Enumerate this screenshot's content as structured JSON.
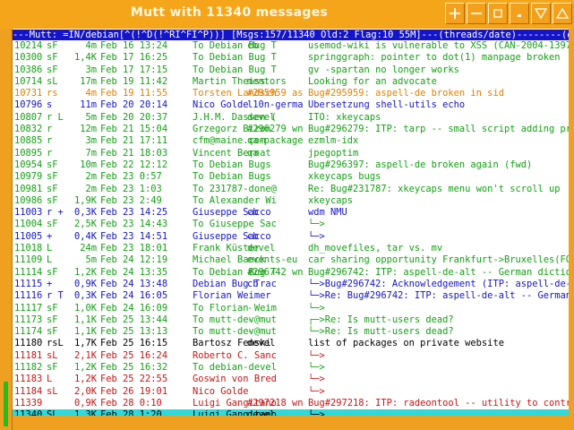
{
  "window": {
    "title": "Mutt with 11340 messages",
    "buttons": [
      "plus-icon",
      "minus-icon",
      "maximize-icon",
      "dot-icon",
      "down-triangle-icon",
      "up-triangle-icon"
    ]
  },
  "statusbar": "---Mutt: =IN/debian[^(!^D(!^RI^FI^P))] [Msgs:157/11340 Old:2 Flag:10 55M]---(threads/date)--------(end)",
  "colors": {
    "status_bg": "#1414c8",
    "selected_bg": "#30d8d8",
    "red": "#c81414",
    "green": "#14a014",
    "blue": "#1414c8",
    "orange": "#e08000",
    "black": "#000000"
  },
  "messages": [
    {
      "num": "10214",
      "flags": "sF",
      "size": "4m",
      "date": "Feb 16 13:24",
      "from": "To Debian Bug T",
      "list": "cb",
      "subject": "usemod-wiki is vulnerable to XSS (CAN-2004-1397)",
      "color": "green"
    },
    {
      "num": "10300",
      "flags": "sF",
      "size": "1,4K",
      "date": "Feb 17 16:25",
      "from": "To Debian Bug T",
      "list": "",
      "subject": "springgraph: pointer to dot(1) manpage broken",
      "color": "green"
    },
    {
      "num": "10386",
      "flags": "sF",
      "size": "3m",
      "date": "Feb 17 17:15",
      "from": "To Debian Bug T",
      "list": "",
      "subject": "gv -spartan no longer works",
      "color": "green"
    },
    {
      "num": "10714",
      "flags": "sL",
      "size": "17m",
      "date": "Feb 19 11:42",
      "from": "Martin Theiss",
      "list": "mentors",
      "subject": "Looking for an advocate",
      "color": "green"
    },
    {
      "num": "10731",
      "flags": "rs",
      "size": "4m",
      "date": "Feb 19 11:55",
      "from": "Torsten Landsch",
      "list": "#295959 as",
      "subject": "Bug#295959: aspell-de broken in sid",
      "color": "orange"
    },
    {
      "num": "10796",
      "flags": "s",
      "size": "11m",
      "date": "Feb 20 20:14",
      "from": "Nico Golde",
      "list": "l10n-germa",
      "subject": "Übersetzung shell-utils echo",
      "color": "blue"
    },
    {
      "num": "10807",
      "flags": "r L",
      "size": "5m",
      "date": "Feb 20 20:37",
      "from": "J.H.M. Dassen (",
      "list": "devel",
      "subject": "ITO: xkeycaps",
      "color": "green"
    },
    {
      "num": "10832",
      "flags": "r",
      "size": "12m",
      "date": "Feb 21 15:04",
      "from": "Grzegorz Bizon",
      "list": "#296279 wn",
      "subject": "Bug#296279: ITP: tarp -- small script adding pro",
      "color": "green"
    },
    {
      "num": "10885",
      "flags": "r",
      "size": "3m",
      "date": "Feb 21 17:11",
      "from": "cfm@maine.com",
      "list": "qa-package",
      "subject": "ezmlm-idx",
      "color": "green"
    },
    {
      "num": "10895",
      "flags": "r",
      "size": "7m",
      "date": "Feb 21 18:03",
      "from": "Vincent Bernat",
      "list": "qa",
      "subject": "jpegoptim",
      "color": "green"
    },
    {
      "num": "10954",
      "flags": "sF",
      "size": "10m",
      "date": "Feb 22 12:12",
      "from": "To Debian Bugs",
      "list": "",
      "subject": "Bug#296397: aspell-de broken again (fwd)",
      "color": "green"
    },
    {
      "num": "10979",
      "flags": "sF",
      "size": "2m",
      "date": "Feb 23 0:57",
      "from": "To Debian Bugs",
      "list": "",
      "subject": "xkeycaps bugs",
      "color": "green"
    },
    {
      "num": "10981",
      "flags": "sF",
      "size": "2m",
      "date": "Feb 23 1:03",
      "from": "To 231787-done@",
      "list": "",
      "subject": "Re: Bug#231787: xkeycaps menu won't scroll up",
      "color": "green"
    },
    {
      "num": "10986",
      "flags": "sF",
      "size": "1,9K",
      "date": "Feb 23 2:49",
      "from": "To Alexander Wi",
      "list": "",
      "subject": "xkeycaps",
      "color": "green"
    },
    {
      "num": "11003",
      "flags": "r +",
      "size": "0,3K",
      "date": "Feb 23 14:25",
      "from": "Giuseppe Sacco",
      "list": "cb",
      "subject": "wdm NMU",
      "color": "blue"
    },
    {
      "num": "11004",
      "flags": "sF",
      "size": "2,5K",
      "date": "Feb 23 14:43",
      "from": "To Giuseppe Sac",
      "list": "-",
      "subject": "└─>",
      "color": "green"
    },
    {
      "num": "11005",
      "flags": "+",
      "size": "0,4K",
      "date": "Feb 23 14:51",
      "from": "Giuseppe Sacco",
      "list": "cb",
      "subject": "└─>",
      "color": "blue"
    },
    {
      "num": "11018",
      "flags": "L",
      "size": "24m",
      "date": "Feb 23 18:01",
      "from": "Frank Küster",
      "list": "devel",
      "subject": "dh_movefiles, tar vs. mv",
      "color": "green"
    },
    {
      "num": "11109",
      "flags": "L",
      "size": "5m",
      "date": "Feb 24 12:19",
      "from": "Michael Banck",
      "list": "events-eu",
      "subject": "car sharing opportunity Frankfurt->Bruxelles(FOS",
      "color": "green"
    },
    {
      "num": "11114",
      "flags": "sF",
      "size": "1,2K",
      "date": "Feb 24 13:35",
      "from": "To Debian Bug T",
      "list": "#296742 wn",
      "subject": "Bug#296742: ITP: aspell-de-alt -- German diction",
      "color": "green"
    },
    {
      "num": "11115",
      "flags": "+",
      "size": "0,9K",
      "date": "Feb 24 13:48",
      "from": "Debian Bug Trac",
      "list": "cb",
      "subject": "└─>Bug#296742: Acknowledgement (ITP: aspell-de-a",
      "color": "blue"
    },
    {
      "num": "11116",
      "flags": "r T",
      "size": "0,3K",
      "date": "Feb 24 16:05",
      "from": "Florian Weimer",
      "list": "",
      "subject": "└─>Re: Bug#296742: ITP: aspell-de-alt -- German",
      "color": "blue"
    },
    {
      "num": "11117",
      "flags": "sF",
      "size": "1,0K",
      "date": "Feb 24 16:09",
      "from": "To Florian Weim",
      "list": "-",
      "subject": "└─>",
      "color": "green"
    },
    {
      "num": "11173",
      "flags": "sF",
      "size": "1,1K",
      "date": "Feb 25 13:44",
      "from": "To mutt-dev@mut",
      "list": "-",
      "subject": "┌─>Re: Is mutt-users dead?",
      "color": "green"
    },
    {
      "num": "11174",
      "flags": "sF",
      "size": "1,1K",
      "date": "Feb 25 13:13",
      "from": "To mutt-dev@mut",
      "list": "-",
      "subject": "└─>Re: Is mutt-users dead?",
      "color": "green"
    },
    {
      "num": "11180",
      "flags": "rsL",
      "size": "1,7K",
      "date": "Feb 25 16:15",
      "from": "Bartosz Fenski",
      "list": "devel",
      "subject": "list of packages on private website",
      "color": "black"
    },
    {
      "num": "11181",
      "flags": "sL",
      "size": "2,1K",
      "date": "Feb 25 16:24",
      "from": "Roberto C. Sanc",
      "list": "",
      "subject": "└─>",
      "color": "red"
    },
    {
      "num": "11182",
      "flags": "sF",
      "size": "1,2K",
      "date": "Feb 25 16:32",
      "from": "To debian-devel",
      "list": "",
      "subject": "└─>",
      "color": "green"
    },
    {
      "num": "11183",
      "flags": "L",
      "size": "1,2K",
      "date": "Feb 25 22:55",
      "from": "Goswin von Bred",
      "list": "",
      "subject": "└─>",
      "color": "red"
    },
    {
      "num": "11184",
      "flags": "sL",
      "size": "2,0K",
      "date": "Feb 26 19:01",
      "from": "Nico Golde",
      "list": "",
      "subject": "└─>",
      "color": "red"
    },
    {
      "num": "11339",
      "flags": "",
      "size": "0,9K",
      "date": "Feb 28 0:10",
      "from": "Luigi Gangitano",
      "list": "#297218 wn",
      "subject": "Bug#297218: ITP: radeontool -- utility to contro",
      "color": "red"
    },
    {
      "num": "11340",
      "flags": "SL",
      "size": "1,3K",
      "date": "Feb 28 1:20",
      "from": "Luigi Gangitano",
      "list": "devel",
      "subject": "└─>",
      "color": "black",
      "selected": true
    }
  ]
}
